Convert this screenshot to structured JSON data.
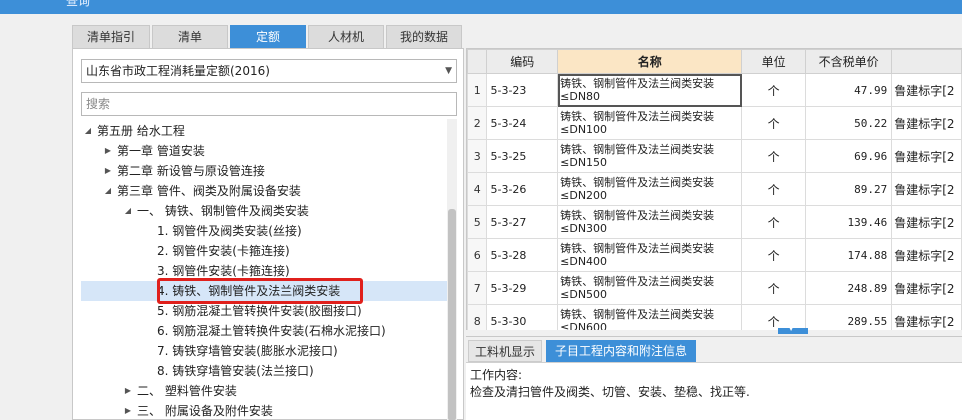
{
  "window": {
    "title": "查询"
  },
  "tabs": [
    {
      "label": "清单指引",
      "active": false
    },
    {
      "label": "清单",
      "active": false
    },
    {
      "label": "定额",
      "active": true
    },
    {
      "label": "人材机",
      "active": false
    },
    {
      "label": "我的数据",
      "active": false
    }
  ],
  "left": {
    "quota_select": "山东省市政工程消耗量定额(2016)",
    "search_placeholder": "搜索",
    "tree": [
      {
        "label": "第五册 给水工程",
        "level": 0,
        "twisty": "◢"
      },
      {
        "label": "第一章 管道安装",
        "level": 1,
        "twisty": "▶"
      },
      {
        "label": "第二章 新设管与原设管连接",
        "level": 1,
        "twisty": "▶"
      },
      {
        "label": "第三章 管件、阀类及附属设备安装",
        "level": 1,
        "twisty": "◢"
      },
      {
        "label": "一、 铸铁、钢制管件及阀类安装",
        "level": 2,
        "twisty": "◢"
      },
      {
        "label": "1. 钢管件及阀类安装(丝接)",
        "level": 3,
        "twisty": ""
      },
      {
        "label": "2. 钢管件安装(卡箍连接)",
        "level": 3,
        "twisty": ""
      },
      {
        "label": "3. 钢管件安装(卡箍连接)",
        "level": 3,
        "twisty": ""
      },
      {
        "label": "4. 铸铁、钢制管件及法兰阀类安装",
        "level": 3,
        "twisty": "",
        "selected": true
      },
      {
        "label": "5. 钢筋混凝土管转换件安装(胶圈接口)",
        "level": 3,
        "twisty": ""
      },
      {
        "label": "6. 钢筋混凝土管转换件安装(石棉水泥接口)",
        "level": 3,
        "twisty": ""
      },
      {
        "label": "7. 铸铁穿墙管安装(膨胀水泥接口)",
        "level": 3,
        "twisty": ""
      },
      {
        "label": "8. 铸铁穿墙管安装(法兰接口)",
        "level": 3,
        "twisty": ""
      },
      {
        "label": "二、 塑料管件安装",
        "level": 2,
        "twisty": "▶"
      },
      {
        "label": "三、 附属设备及附件安装",
        "level": 2,
        "twisty": "▶"
      }
    ]
  },
  "grid": {
    "headers": {
      "code": "编码",
      "name": "名称",
      "unit": "单位",
      "price": "不含税单价"
    },
    "rows": [
      {
        "idx": "1",
        "code": "5-3-23",
        "name": "铸铁、钢制管件及法兰阀类安装 ≤DN80",
        "unit": "个",
        "price": "47.99",
        "remark": "鲁建标字[2"
      },
      {
        "idx": "2",
        "code": "5-3-24",
        "name": "铸铁、钢制管件及法兰阀类安装 ≤DN100",
        "unit": "个",
        "price": "50.22",
        "remark": "鲁建标字[2"
      },
      {
        "idx": "3",
        "code": "5-3-25",
        "name": "铸铁、钢制管件及法兰阀类安装 ≤DN150",
        "unit": "个",
        "price": "69.96",
        "remark": "鲁建标字[2"
      },
      {
        "idx": "4",
        "code": "5-3-26",
        "name": "铸铁、钢制管件及法兰阀类安装 ≤DN200",
        "unit": "个",
        "price": "89.27",
        "remark": "鲁建标字[2"
      },
      {
        "idx": "5",
        "code": "5-3-27",
        "name": "铸铁、钢制管件及法兰阀类安装 ≤DN300",
        "unit": "个",
        "price": "139.46",
        "remark": "鲁建标字[2"
      },
      {
        "idx": "6",
        "code": "5-3-28",
        "name": "铸铁、钢制管件及法兰阀类安装 ≤DN400",
        "unit": "个",
        "price": "174.88",
        "remark": "鲁建标字[2"
      },
      {
        "idx": "7",
        "code": "5-3-29",
        "name": "铸铁、钢制管件及法兰阀类安装 ≤DN500",
        "unit": "个",
        "price": "248.89",
        "remark": "鲁建标字[2"
      },
      {
        "idx": "8",
        "code": "5-3-30",
        "name": "铸铁、钢制管件及法兰阀类安装 ≤DN600",
        "unit": "个",
        "price": "289.55",
        "remark": "鲁建标字[2"
      }
    ]
  },
  "bottom": {
    "tab1": "工料机显示",
    "tab2": "子目工程内容和附注信息",
    "content_label": "工作内容:",
    "content_text": "检查及清扫管件及阀类、切管、安装、垫稳、找正等."
  },
  "colors": {
    "accent": "#3d8fd8",
    "highlight": "#e0201c",
    "header_name": "#fbe6c5"
  }
}
